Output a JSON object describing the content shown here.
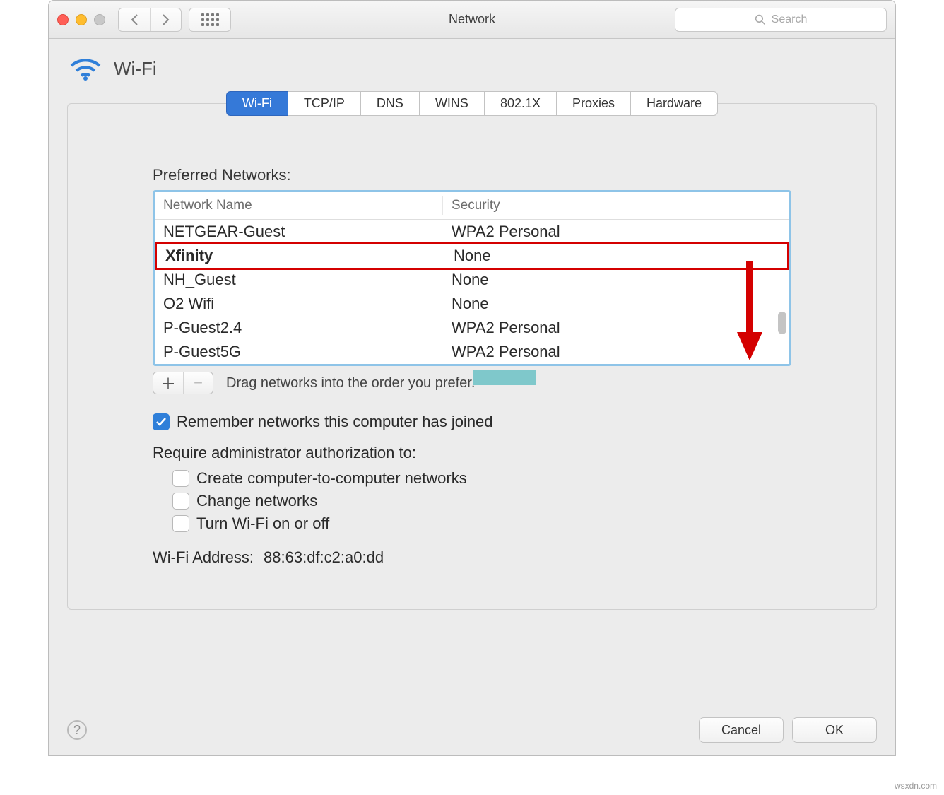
{
  "window": {
    "title": "Network"
  },
  "search": {
    "placeholder": "Search"
  },
  "header": {
    "title": "Wi-Fi"
  },
  "tabs": [
    "Wi-Fi",
    "TCP/IP",
    "DNS",
    "WINS",
    "802.1X",
    "Proxies",
    "Hardware"
  ],
  "active_tab_index": 0,
  "preferred": {
    "label": "Preferred Networks:",
    "columns": {
      "name": "Network Name",
      "security": "Security"
    },
    "rows": [
      {
        "name": "NETGEAR-Guest",
        "security": "WPA2 Personal",
        "highlight": false
      },
      {
        "name": "Xfinity",
        "security": "None",
        "highlight": true
      },
      {
        "name": "NH_Guest",
        "security": "None",
        "highlight": false
      },
      {
        "name": "O2 Wifi",
        "security": "None",
        "highlight": false
      },
      {
        "name": "P-Guest2.4",
        "security": "WPA2 Personal",
        "highlight": false
      },
      {
        "name": "P-Guest5G",
        "security": "WPA2 Personal",
        "highlight": false
      }
    ],
    "hint": "Drag networks into the order you prefer."
  },
  "remember": {
    "label": "Remember networks this computer has joined",
    "checked": true
  },
  "require": {
    "label": "Require administrator authorization to:",
    "items": [
      {
        "label": "Create computer-to-computer networks",
        "checked": false
      },
      {
        "label": "Change networks",
        "checked": false
      },
      {
        "label": "Turn Wi-Fi on or off",
        "checked": false
      }
    ]
  },
  "address": {
    "label": "Wi-Fi Address:",
    "value": "88:63:df:c2:a0:dd"
  },
  "footer": {
    "cancel": "Cancel",
    "ok": "OK"
  },
  "credit": "wsxdn.com"
}
